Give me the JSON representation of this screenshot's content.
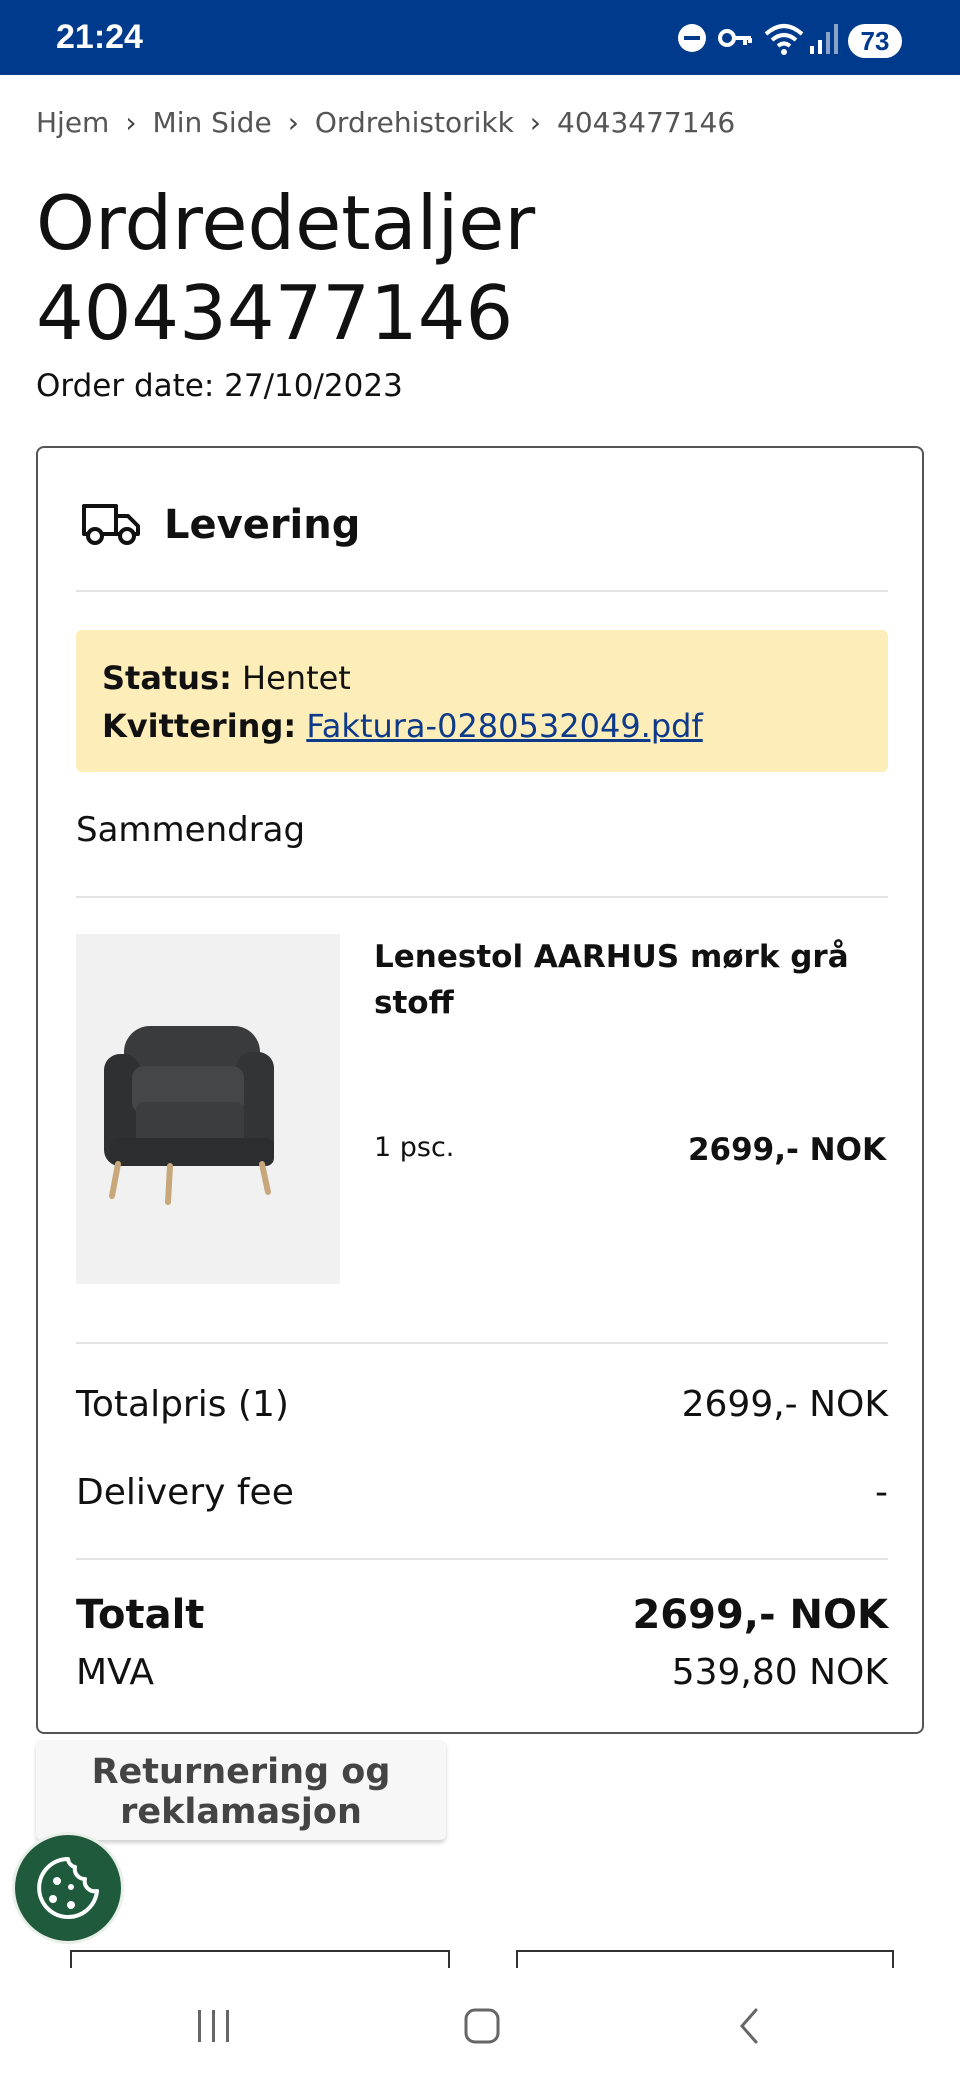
{
  "status_bar": {
    "time": "21:24",
    "battery": "73"
  },
  "breadcrumb": [
    "Hjem",
    "Min Side",
    "Ordrehistorikk",
    "4043477146"
  ],
  "breadcrumb_separator": "›",
  "page": {
    "title_line1": "Ordredetaljer",
    "title_line2": "4043477146",
    "order_date": "Order date: 27/10/2023"
  },
  "delivery": {
    "heading": "Levering",
    "status_label": "Status:",
    "status_value": "Hentet",
    "receipt_label": "Kvittering:",
    "receipt_link": "Faktura-0280532049.pdf"
  },
  "summary": {
    "heading": "Sammendrag",
    "items": [
      {
        "name": "Lenestol AARHUS mørk grå stoff",
        "qty": "1 psc.",
        "price": "2699,- NOK"
      }
    ],
    "total_price_label": "Totalpris (1)",
    "total_price_value": "2699,- NOK",
    "delivery_fee_label": "Delivery fee",
    "delivery_fee_value": "-",
    "total_label": "Totalt",
    "total_value": "2699,- NOK",
    "vat_label": "MVA",
    "vat_value": "539,80 NOK"
  },
  "buttons": {
    "return_line1": "Returnering og",
    "return_line2": "reklamasjon"
  },
  "colors": {
    "status_bar": "#003a8c",
    "status_box_bg": "#fdedb8",
    "link": "#0d3a8a",
    "cookie_button": "#1f5a3d"
  },
  "icons": {
    "delivery": "truck-icon",
    "cookie": "cookie-icon",
    "nav_recent": "recent-apps-icon",
    "nav_home": "home-icon",
    "nav_back": "back-icon"
  }
}
